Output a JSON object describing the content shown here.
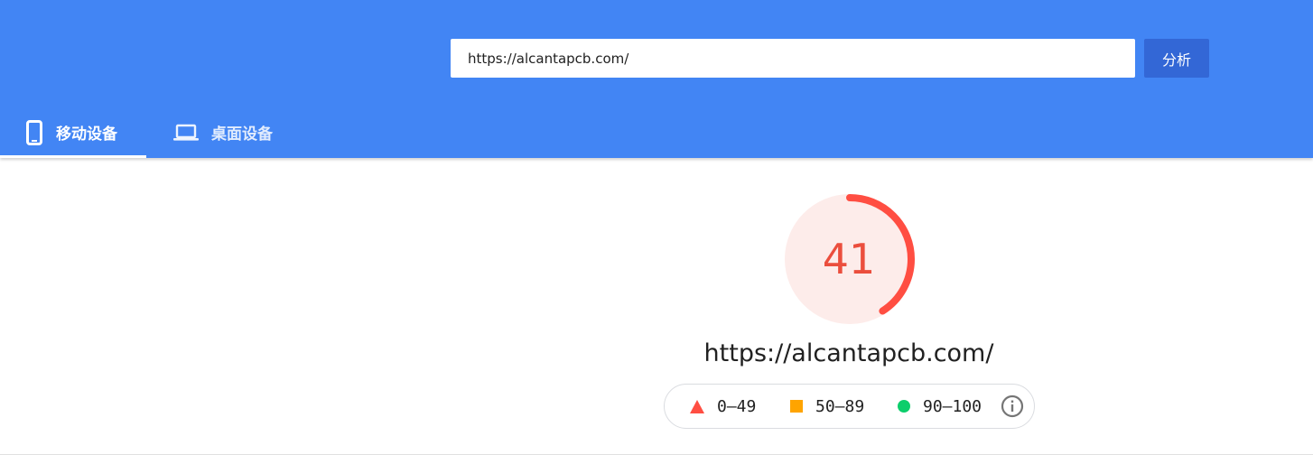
{
  "search": {
    "url_value": "https://alcantapcb.com/",
    "analyze_label": "分析"
  },
  "tabs": [
    {
      "label": "移动设备",
      "icon": "smartphone-icon",
      "selected": true
    },
    {
      "label": "桌面设备",
      "icon": "laptop-icon",
      "selected": false
    }
  ],
  "result": {
    "score": "41",
    "score_fraction": 0.41,
    "url": "https://alcantapcb.com/"
  },
  "legend": [
    {
      "icon": "triangle-icon",
      "label": "0–49",
      "color": "#ff4e42"
    },
    {
      "icon": "square-icon",
      "label": "50–89",
      "color": "#ffa400"
    },
    {
      "icon": "circle-icon",
      "label": "90–100",
      "color": "#0cce6b"
    }
  ],
  "colors": {
    "header": "#4285f4",
    "button": "#3367d6",
    "score_fail": "#ff4e42",
    "score_fail_bg": "#fdecea"
  }
}
